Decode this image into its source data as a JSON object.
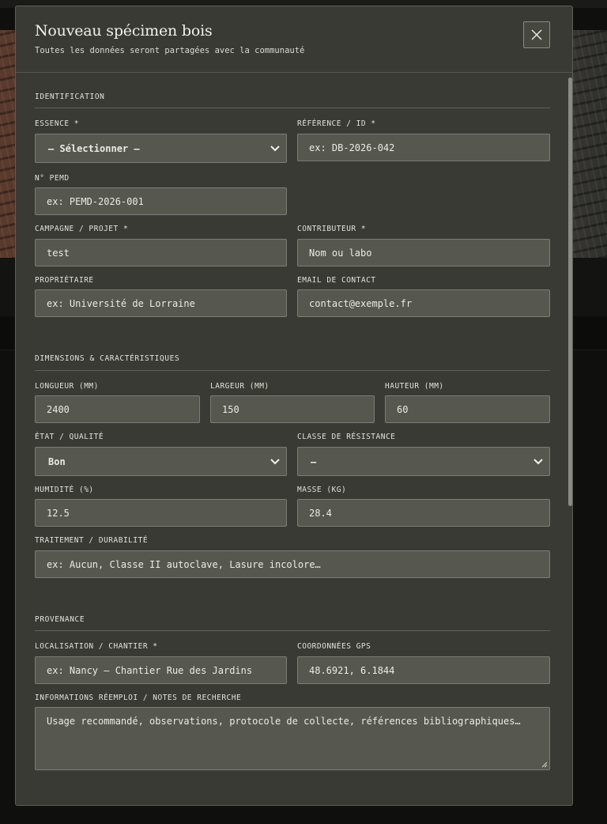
{
  "modal": {
    "title": "Nouveau spécimen bois",
    "subtitle": "Toutes les données seront partagées avec la communauté"
  },
  "icons": {
    "close": "close-icon",
    "select": "chevron-down-icon"
  },
  "sections": {
    "identification": {
      "title": "IDENTIFICATION",
      "essence": {
        "label": "ESSENCE *",
        "value": "— Sélectionner —"
      },
      "reference": {
        "label": "RÉFÉRENCE / ID *",
        "placeholder": "ex: DB-2026-042"
      },
      "pemd": {
        "label": "N° PEMD",
        "placeholder": "ex: PEMD-2026-001"
      },
      "campagne": {
        "label": "CAMPAGNE / PROJET *",
        "value": "test"
      },
      "contributeur": {
        "label": "CONTRIBUTEUR *",
        "placeholder": "Nom ou labo"
      },
      "proprietaire": {
        "label": "PROPRIÉTAIRE",
        "placeholder": "ex: Université de Lorraine"
      },
      "email": {
        "label": "EMAIL DE CONTACT",
        "placeholder": "contact@exemple.fr"
      }
    },
    "dimensions": {
      "title": "DIMENSIONS & CARACTÉRISTIQUES",
      "longueur": {
        "label": "LONGUEUR (MM)",
        "value": "2400"
      },
      "largeur": {
        "label": "LARGEUR (MM)",
        "value": "150"
      },
      "hauteur": {
        "label": "HAUTEUR (MM)",
        "value": "60"
      },
      "etat": {
        "label": "ÉTAT / QUALITÉ",
        "value": "Bon"
      },
      "classe": {
        "label": "CLASSE DE RÉSISTANCE",
        "value": "—"
      },
      "humidite": {
        "label": "HUMIDITÉ (%)",
        "value": "12.5"
      },
      "masse": {
        "label": "MASSE (KG)",
        "value": "28.4"
      },
      "traitement": {
        "label": "TRAITEMENT / DURABILITÉ",
        "placeholder": "ex: Aucun, Classe II autoclave, Lasure incolore…"
      }
    },
    "provenance": {
      "title": "PROVENANCE",
      "localisation": {
        "label": "LOCALISATION / CHANTIER *",
        "placeholder": "ex: Nancy — Chantier Rue des Jardins"
      },
      "gps": {
        "label": "COORDONNÉES GPS",
        "value": "48.6921, 6.1844"
      },
      "notes": {
        "label": "INFORMATIONS RÉEMPLOI / NOTES DE RECHERCHE",
        "placeholder": "Usage recommandé, observations, protocole de collecte, références bibliographiques…"
      }
    }
  }
}
